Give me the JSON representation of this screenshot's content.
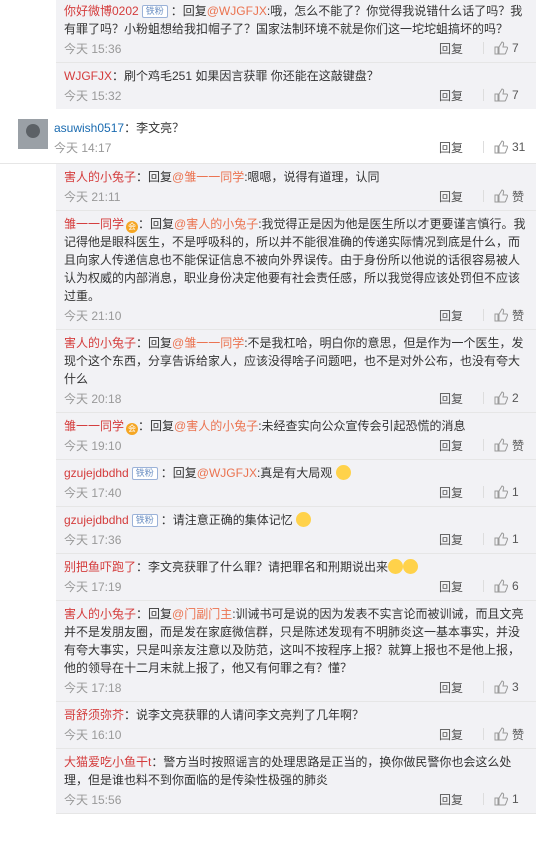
{
  "colors": {
    "accent": "#eb7350",
    "link_blue": "#1a6bb0",
    "sub_bg": "#f2f2f5"
  },
  "subs1": [
    {
      "user": "你好微博0202",
      "badge": "铁粉",
      "pre": "：回复",
      "at": "@WJGFJX",
      "text": ":哦，怎么不能了？你觉得我说错什么话了吗？我有罪了吗？小粉蛆想给我扣帽子了？国家法制环境不就是你们这一坨坨蛆搞坏的吗？",
      "time": "今天 15:36",
      "reply": "回复",
      "likes": "7"
    },
    {
      "user": "WJGFJX",
      "badge": "",
      "pre": "",
      "at": "",
      "text": "：刷个鸡毛251  如果因言获罪  你还能在这敲键盘？",
      "time": "今天 15:32",
      "reply": "回复",
      "likes": "7"
    }
  ],
  "main_comment": {
    "user": "asuwish0517",
    "text": "：李文亮？",
    "time": "今天 14:17",
    "reply": "回复",
    "likes": "31"
  },
  "subs2": [
    {
      "user": "害人的小兔子",
      "vip": "",
      "badge": "",
      "pre": "：回复",
      "at": "@雏一一同学",
      "text": ":嗯嗯，说得有道理，认同",
      "time": "今天 21:11",
      "reply": "回复",
      "likes": "赞"
    },
    {
      "user": "雏一一同学",
      "vip": "会",
      "badge": "",
      "pre": "：回复",
      "at": "@害人的小兔子",
      "text": ":我觉得正是因为他是医生所以才更要谨言慎行。我记得他是眼科医生，不是呼吸科的，所以并不能很准确的传递实际情况到底是什么，而且向家人传递信息也不能保证信息不被向外界误传。由于身份所以他说的话很容易被人认为权威的内部消息，职业身份决定他要有社会责任感，所以我觉得应该处罚但不应该过重。",
      "time": "今天 21:10",
      "reply": "回复",
      "likes": "赞"
    },
    {
      "user": "害人的小兔子",
      "vip": "",
      "badge": "",
      "pre": "：回复",
      "at": "@雏一一同学",
      "text": ":不是我杠哈，明白你的意思，但是作为一个医生，发现个这个东西，分享告诉给家人，应该没得啥子问题吧，也不是对外公布，也没有夸大什么",
      "time": "今天 20:18",
      "reply": "回复",
      "likes": "2"
    },
    {
      "user": "雏一一同学",
      "vip": "会",
      "badge": "",
      "pre": "：回复",
      "at": "@害人的小兔子",
      "text": ":未经查实向公众宣传会引起恐慌的消息",
      "time": "今天 19:10",
      "reply": "回复",
      "likes": "赞"
    },
    {
      "user": "gzujejdbdhd",
      "vip": "",
      "badge": "铁粉",
      "pre": "：回复",
      "at": "@WJGFJX",
      "text": ":真是有大局观",
      "time": "今天 17:40",
      "reply": "回复",
      "likes": "1",
      "emoji": true
    },
    {
      "user": "gzujejdbdhd",
      "vip": "",
      "badge": "铁粉",
      "pre": "",
      "at": "",
      "text": "：请注意正确的集体记忆",
      "time": "今天 17:36",
      "reply": "回复",
      "likes": "1",
      "emoji": true
    },
    {
      "user": "别把鱼吓跑了",
      "vip": "",
      "badge": "",
      "pre": "",
      "at": "",
      "text": "：李文亮获罪了什么罪？请把罪名和刑期说出来",
      "time": "今天 17:19",
      "reply": "回复",
      "likes": "6",
      "emoji2": true
    },
    {
      "user": "害人的小兔子",
      "vip": "",
      "badge": "",
      "pre": "：回复",
      "at": "@门副门主",
      "text": ":训诫书可是说的因为发表不实言论而被训诫，而且文亮并不是发朋友圈，而是发在家庭微信群，只是陈述发现有不明肺炎这一基本事实，并没有夸大事实，只是叫亲友注意以及防范，这叫不按程序上报？就算上报也不是他上报，他的领导在十二月末就上报了，他又有何罪之有？懂？",
      "time": "今天 17:18",
      "reply": "回复",
      "likes": "3"
    },
    {
      "user": "哥舒须弥芥",
      "vip": "",
      "badge": "",
      "pre": "",
      "at": "",
      "text": "：说李文亮获罪的人请问李文亮判了几年啊？",
      "time": "今天 16:10",
      "reply": "回复",
      "likes": "赞"
    },
    {
      "user": "大猫爱吃小鱼干t",
      "vip": "",
      "badge": "",
      "pre": "",
      "at": "",
      "text": "：警方当时按照谣言的处理思路是正当的，换你做民警你也会这么处理，但是谁也料不到你面临的是传染性极强的肺炎",
      "time": "今天 15:56",
      "reply": "回复",
      "likes": "1"
    }
  ]
}
